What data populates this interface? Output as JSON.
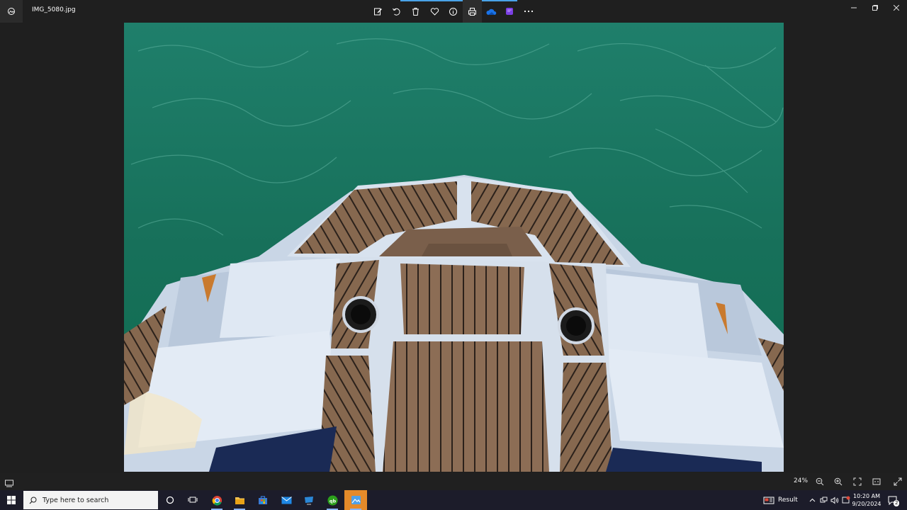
{
  "window": {
    "filename": "IMG_5080.jpg",
    "controls": [
      "minimize",
      "maximize",
      "close"
    ]
  },
  "toolbar": {
    "buttons": [
      {
        "name": "edit-image",
        "icon": "edit-icon"
      },
      {
        "name": "rotate",
        "icon": "rotate-icon"
      },
      {
        "name": "delete",
        "icon": "trash-icon"
      },
      {
        "name": "favorite",
        "icon": "heart-icon"
      },
      {
        "name": "file-info",
        "icon": "info-icon"
      },
      {
        "name": "print",
        "icon": "print-icon"
      },
      {
        "name": "onedrive",
        "icon": "cloud-icon"
      },
      {
        "name": "clipchamp",
        "icon": "clipchamp-icon"
      },
      {
        "name": "more",
        "icon": "more-icon"
      }
    ]
  },
  "statusbar": {
    "zoom": "24%"
  },
  "taskbar": {
    "search_placeholder": "Type here to search",
    "apps": [
      "cortana",
      "task-view",
      "chrome",
      "file-explorer",
      "microsoft-store",
      "mail",
      "remote-desktop",
      "quickbooks",
      "photos"
    ],
    "result_label": "Result",
    "time": "10:20 AM",
    "date": "9/20/2024",
    "notification_count": "2"
  },
  "colors": {
    "accent": "#4aa3e8",
    "taskbar_highlight": "#e48a2a",
    "water": "#1b7a62",
    "hull": "#c9d6e6",
    "deck": "#8a6e57"
  }
}
